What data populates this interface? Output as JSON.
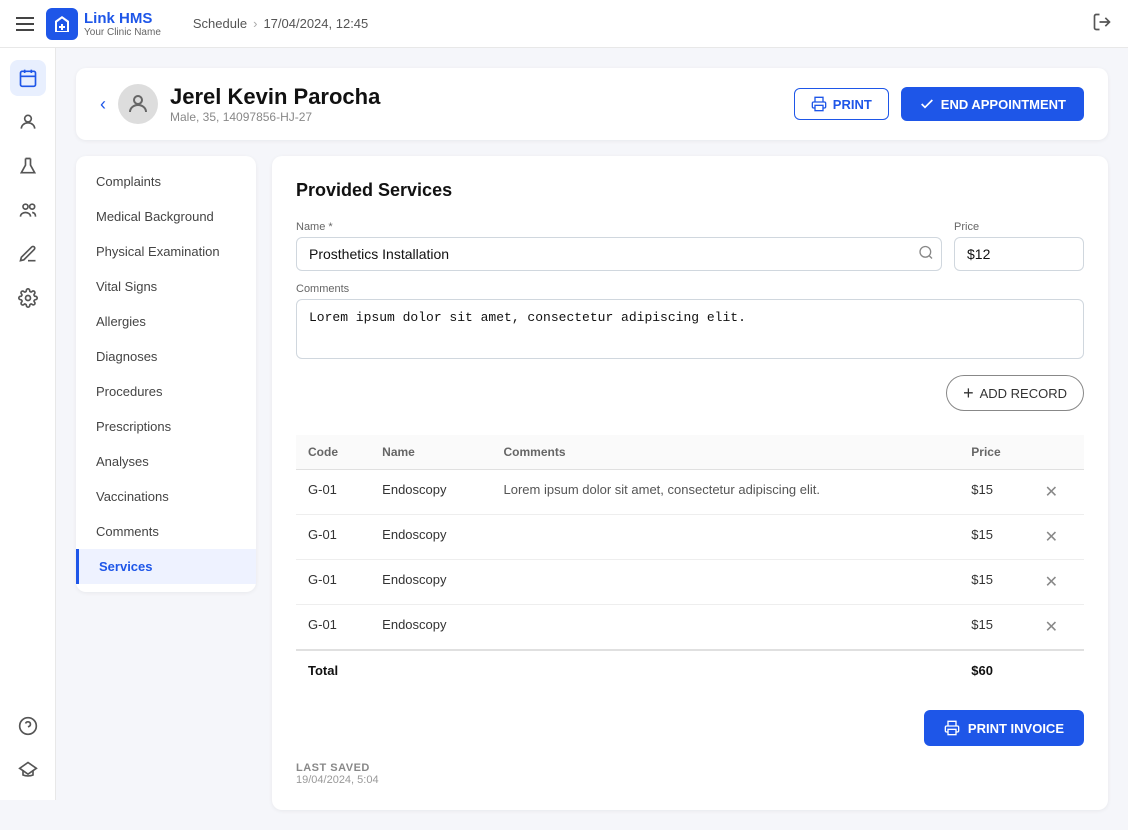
{
  "topNav": {
    "menuLabel": "Menu",
    "logoText": "Link HMS",
    "logoSub": "Your Clinic Name",
    "breadcrumb": {
      "schedule": "Schedule",
      "separator": "›",
      "datetime": "17/04/2024, 12:45"
    }
  },
  "sidebar": {
    "items": [
      {
        "name": "calendar-icon",
        "label": "Calendar"
      },
      {
        "name": "person-icon",
        "label": "Person"
      },
      {
        "name": "flask-icon",
        "label": "Lab"
      },
      {
        "name": "group-icon",
        "label": "Group"
      },
      {
        "name": "pen-icon",
        "label": "Pen"
      },
      {
        "name": "gear-icon",
        "label": "Settings"
      }
    ],
    "bottom": [
      {
        "name": "question-icon",
        "label": "Help"
      },
      {
        "name": "graduation-icon",
        "label": "Training"
      }
    ]
  },
  "patient": {
    "name": "Jerel Kevin Parocha",
    "meta": "Male, 35, 14097856-HJ-27",
    "printLabel": "PRINT",
    "endAppointmentLabel": "END APPOINTMENT"
  },
  "menu": {
    "items": [
      "Complaints",
      "Medical Background",
      "Physical Examination",
      "Vital Signs",
      "Allergies",
      "Diagnoses",
      "Procedures",
      "Prescriptions",
      "Analyses",
      "Vaccinations",
      "Comments",
      "Services"
    ],
    "active": "Services"
  },
  "services": {
    "title": "Provided Services",
    "form": {
      "nameLabel": "Name *",
      "namePlaceholder": "Prosthetics Installation",
      "priceLabel": "Price",
      "priceValue": "$12",
      "commentsLabel": "Comments",
      "commentsValue": "Lorem ipsum dolor sit amet, consectetur adipiscing elit.",
      "addRecordLabel": "ADD RECORD"
    },
    "table": {
      "columns": [
        "Code",
        "Name",
        "Comments",
        "Price"
      ],
      "rows": [
        {
          "code": "G-01",
          "name": "Endoscopy",
          "comments": "Lorem ipsum dolor sit amet, consectetur adipiscing elit.",
          "price": "$15"
        },
        {
          "code": "G-01",
          "name": "Endoscopy",
          "comments": "",
          "price": "$15"
        },
        {
          "code": "G-01",
          "name": "Endoscopy",
          "comments": "",
          "price": "$15"
        },
        {
          "code": "G-01",
          "name": "Endoscopy",
          "comments": "",
          "price": "$15"
        }
      ],
      "totalLabel": "Total",
      "totalValue": "$60"
    },
    "printInvoiceLabel": "PRINT INVOICE"
  },
  "footer": {
    "lastSavedLabel": "LAST SAVED",
    "lastSavedDate": "19/04/2024, 5:04"
  }
}
